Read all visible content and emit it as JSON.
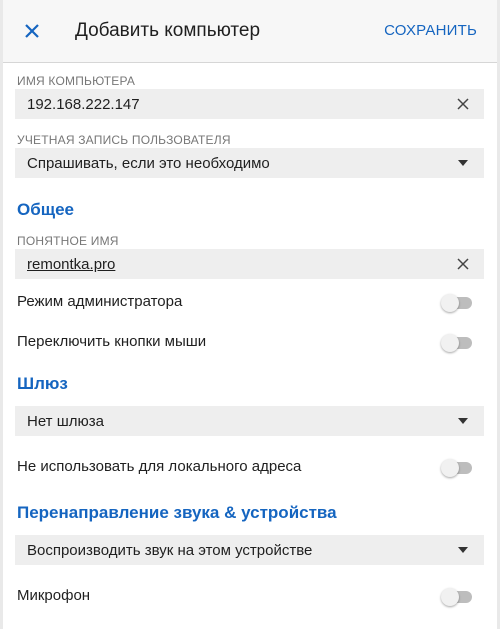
{
  "header": {
    "title": "Добавить компьютер",
    "save_label": "СОХРАНИТЬ"
  },
  "computer_name": {
    "label": "ИМЯ КОМПЬЮТЕРА",
    "value": "192.168.222.147"
  },
  "user_account": {
    "label": "УЧЕТНАЯ ЗАПИСЬ ПОЛЬЗОВАТЕЛЯ",
    "selected": "Спрашивать, если это необходимо"
  },
  "general": {
    "title": "Общее",
    "friendly_name_label": "ПОНЯТНОЕ ИМЯ",
    "friendly_name_value": "remontka.pro",
    "admin_mode_label": "Режим администратора",
    "admin_mode_on": false,
    "swap_mouse_label": "Переключить кнопки мыши",
    "swap_mouse_on": false
  },
  "gateway": {
    "title": "Шлюз",
    "selected": "Нет шлюза",
    "bypass_local_label": "Не использовать для локального адреса",
    "bypass_local_on": false
  },
  "redirection": {
    "title": "Перенаправление звука & устройства",
    "sound_selected": "Воспроизводить звук на этом устройстве",
    "microphone_label": "Микрофон",
    "microphone_on": false
  },
  "colors": {
    "accent": "#1565c0",
    "toggle_off_track": "#bdbdbd",
    "field_background": "#eeeeee"
  }
}
